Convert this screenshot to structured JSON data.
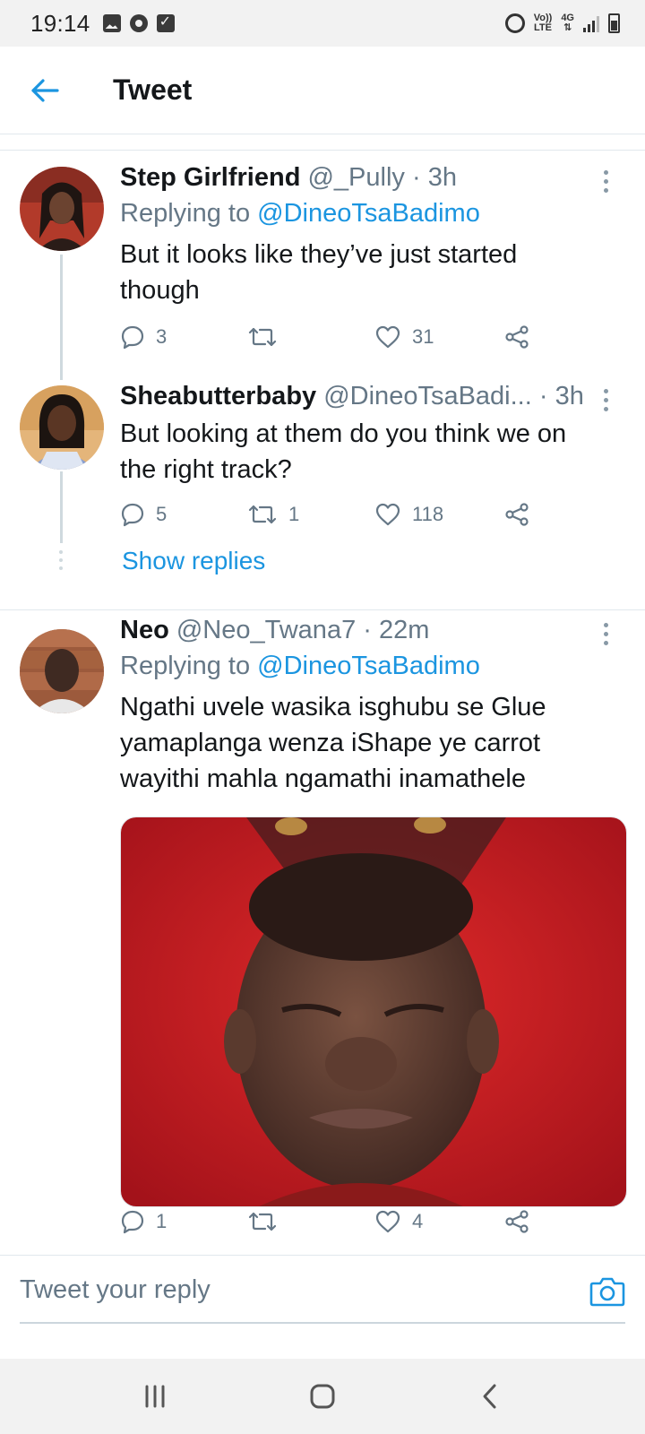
{
  "status_bar": {
    "time": "19:14",
    "volte": "Vo))",
    "lte": "LTE",
    "network": "4G",
    "icons": [
      "image-icon",
      "gear-icon",
      "checkbox-icon",
      "alarm-icon",
      "signal-icon",
      "battery-icon"
    ]
  },
  "header": {
    "title": "Tweet",
    "back_icon": "arrow-left-icon"
  },
  "colors": {
    "accent": "#1b95e0",
    "text_primary": "#14171a",
    "text_secondary": "#657786",
    "divider": "#e1e8ed"
  },
  "tweets": [
    {
      "name": "Step Girlfriend",
      "handle": "@_Pully",
      "time": "· 3h",
      "reply_prefix": "Replying to",
      "reply_to": "@DineoTsaBadimo",
      "text": "But it looks like they’ve just started though",
      "replies": "3",
      "retweets": "",
      "likes": "31"
    },
    {
      "name": "Sheabutterbaby",
      "handle": "@DineoTsaBadi...",
      "time": "· 3h",
      "text": "But looking at them do you think we on the right track?",
      "replies": "5",
      "retweets": "1",
      "likes": "118"
    },
    {
      "name": "Neo",
      "handle": "@Neo_Twana7",
      "time": "· 22m",
      "reply_prefix": "Replying to",
      "reply_to": "@DineoTsaBadimo",
      "text": "Ngathi uvele wasika isghubu se Glue yamaplanga  wenza iShape ye carrot wayithi mahla ngamathi inamathele",
      "replies": "1",
      "retweets": "",
      "likes": "4"
    }
  ],
  "show_replies": "Show replies",
  "reply_bar": {
    "placeholder": "Tweet your reply",
    "camera_icon": "camera-icon"
  },
  "nav_bar": {
    "icons": [
      "recents-icon",
      "home-icon",
      "back-icon"
    ]
  }
}
